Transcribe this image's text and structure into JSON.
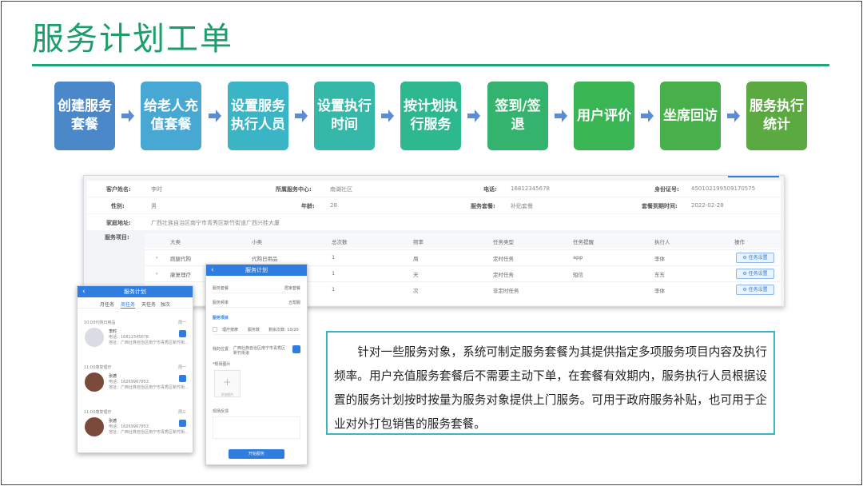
{
  "title": "服务计划工单",
  "steps": [
    {
      "label": "创建服务套餐",
      "color": "#4a88c9"
    },
    {
      "label": "给老人充值套餐",
      "color": "#47a9d3"
    },
    {
      "label": "设置服务执行人员",
      "color": "#3ab5c6"
    },
    {
      "label": "设置执行时间",
      "color": "#35b8a7"
    },
    {
      "label": "按计划执行服务",
      "color": "#2eb88e"
    },
    {
      "label": "签到/签退",
      "color": "#33b36d"
    },
    {
      "label": "用户评价",
      "color": "#3ab554"
    },
    {
      "label": "坐席回访",
      "color": "#47b04a"
    },
    {
      "label": "服务执行统计",
      "color": "#5aaa41"
    }
  ],
  "arrow_color": "#5b8dd6",
  "desk": {
    "row1": {
      "name_label": "客户姓名:",
      "name": "李时",
      "center_label": "所属服务中心:",
      "center": "南湖社区",
      "phone_label": "电话:",
      "phone": "16812345678",
      "id_label": "身份证号:",
      "id": "450102199509170575"
    },
    "row2": {
      "gender_label": "性别:",
      "gender": "男",
      "age_label": "年龄:",
      "age": "28",
      "package_label": "服务套餐:",
      "package": "补贴套餐",
      "expire_label": "套餐到期时间:",
      "expire": "2022-02-28"
    },
    "row3": {
      "addr_label": "家庭地址:",
      "addr": "广西壮族自治区南宁市青秀区新竹街道广西兴桂大厦"
    },
    "services_label": "服务项目:",
    "columns": [
      "大类",
      "小类",
      "总次数",
      "频率",
      "任务类型",
      "任务提醒",
      "执行人",
      "操作"
    ],
    "rows": [
      {
        "cat": "跑腿代购",
        "sub": "代购日用品",
        "count": "1",
        "freq": "周",
        "type": "定时任务",
        "remind": "app",
        "exec": "李体",
        "op": "⚙ 任务设置"
      },
      {
        "cat": "康复理疗",
        "sub": "",
        "count": "1",
        "freq": "天",
        "type": "定时任务",
        "remind": "短信",
        "exec": "东东",
        "op": "⚙ 任务设置"
      },
      {
        "cat": "",
        "sub": "",
        "count": "1",
        "freq": "次",
        "type": "非定时任务",
        "remind": "",
        "exec": "李体",
        "op": "⚙ 任务设置"
      }
    ]
  },
  "phone1": {
    "title": "服务计划",
    "tabs": [
      "月任务",
      "周任务",
      "天任务",
      "独次"
    ],
    "cards": [
      {
        "time": "10:00代购日用品",
        "week": "周一",
        "name": "李时",
        "phone": "电话：16812345678",
        "addr": "地址：广西壮族自治区南宁市青秀区新竹街..."
      },
      {
        "time": "11:00康复理疗",
        "week": "周一",
        "name": "张德",
        "phone": "电话：16269967853",
        "addr": "地址：广西壮族自治区南宁市青秀区新竹街..."
      },
      {
        "time": "11:00康复理疗",
        "week": "周三",
        "name": "张德",
        "phone": "电话：16269967853",
        "addr": "地址：广西壮族自治区南宁市青秀区新竹街..."
      }
    ]
  },
  "phone2": {
    "title": "服务计划",
    "r1_label": "服务套餐",
    "r1_value": "居家套餐",
    "r2_label": "服务频率",
    "r2_value": "五帮服",
    "section": "服务项目",
    "item": "理疗按摩",
    "item_b": "服务数",
    "item_c": "剩余次数: 10/20",
    "loc_label": "我的位置",
    "loc_value": "广西壮族自治区南宁市青秀区新竹街道",
    "photo_label": "*现场图片",
    "photo_hint": "添加图片",
    "remark_label": "现场反馈",
    "button": "开始服务"
  },
  "description": "针对一些服务对象，系统可制定服务套餐为其提供指定多项服务项目内容及执行频率。用户充值服务套餐后不需要主动下单，在套餐有效期内，服务执行人员根据设置的服务计划按时按量为服务对象提供上门服务。可用于政府服务补贴，也可用于企业对外打包销售的服务套餐。"
}
